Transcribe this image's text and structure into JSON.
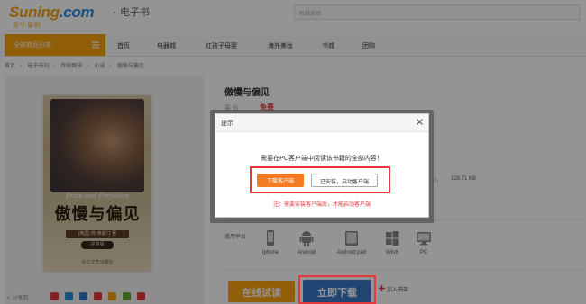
{
  "header": {
    "logo_main": "Suning",
    "logo_dotcom": ".com",
    "logo_sub": "苏宁易购",
    "section_title": "电子书",
    "search_placeholder": "机械游戏"
  },
  "nav": {
    "all_categories": "全部商品分类",
    "items": [
      "首页",
      "电器城",
      "红孩子母婴",
      "海外美妆",
      "书城",
      "团购"
    ]
  },
  "breadcrumb": [
    "首页",
    "电子书刊",
    "传统图书",
    "小说",
    "傲慢与偏见"
  ],
  "cover": {
    "script_title": "Pride and Prejudice",
    "title": "傲慢与偏见",
    "author": "[英国] 简·奥斯汀 著",
    "badge": "完整版",
    "publisher": "长江文艺出版社"
  },
  "share": {
    "label": "分享到:"
  },
  "product": {
    "title": "傲慢与偏见",
    "price_label": "易 价 :",
    "price_value": "免费",
    "size_label": "小",
    "size_value": "328.71 KB",
    "platform_label": "适用平台",
    "platforms": [
      "Iphone",
      "Android",
      "Android pad",
      "Win8",
      "PC"
    ],
    "trial_button": "在线试读",
    "download_button": "立即下载",
    "add_shelf": "加入书架"
  },
  "dialog": {
    "title": "提示",
    "message": "需要在PC客户端中阅读该书籍的全部内容！",
    "download_client_button": "下载客户端",
    "launch_client_button": "已安装，启动客户端",
    "note": "注：需要安装客户端后，才能启动客户端"
  },
  "colors": {
    "brand_orange": "#f7a20c",
    "brand_blue": "#2a8ad8",
    "download_blue": "#3a78c7",
    "highlight_red": "#e4393c"
  }
}
